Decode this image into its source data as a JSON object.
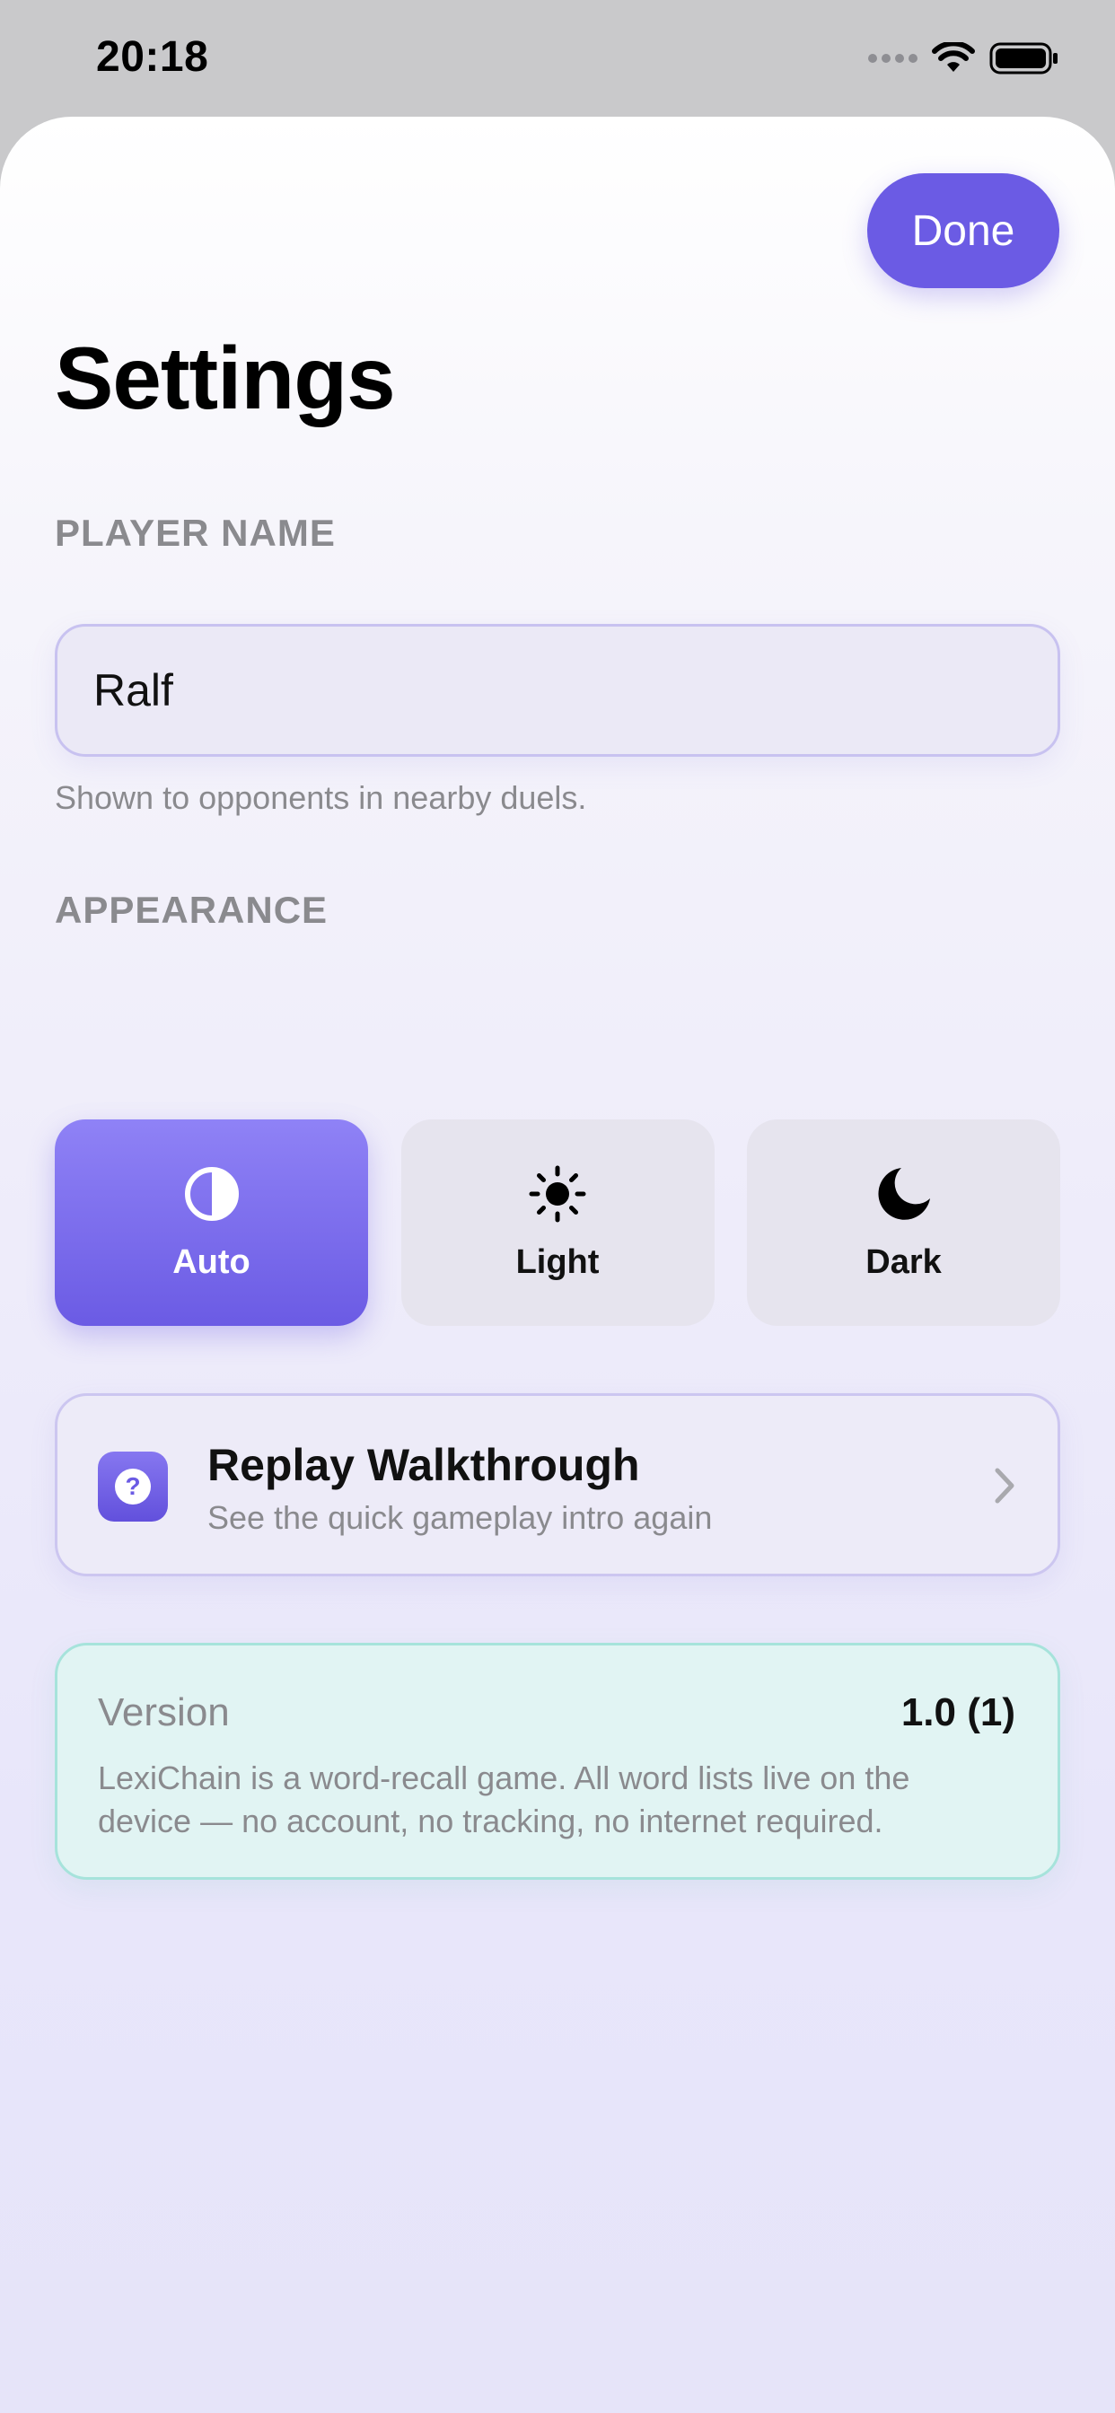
{
  "status_bar": {
    "time": "20:18"
  },
  "header": {
    "done_label": "Done",
    "title": "Settings"
  },
  "player_name": {
    "section_title": "PLAYER NAME",
    "value": "Ralf",
    "hint": "Shown to opponents in nearby duels."
  },
  "appearance": {
    "section_title": "APPEARANCE",
    "options": [
      {
        "label": "Auto",
        "icon": "half-circle-icon",
        "selected": true
      },
      {
        "label": "Light",
        "icon": "sun-icon",
        "selected": false
      },
      {
        "label": "Dark",
        "icon": "moon-icon",
        "selected": false
      }
    ]
  },
  "walkthrough": {
    "icon": "question-icon",
    "title": "Replay Walkthrough",
    "subtitle": "See the quick gameplay intro again"
  },
  "about": {
    "version_label": "Version",
    "version_value": "1.0 (1)",
    "description": "LexiChain is a word-recall game. All word lists live on the device — no account, no tracking, no internet required."
  },
  "colors": {
    "accent": "#6b5be4",
    "sheet_background": "#efedfa",
    "info_card": "#e1f4f3"
  }
}
